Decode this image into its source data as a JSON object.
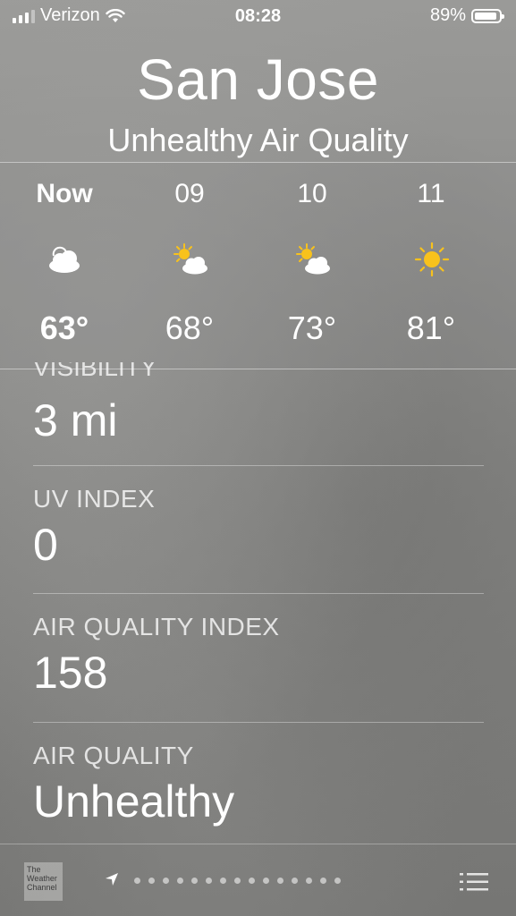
{
  "status_bar": {
    "carrier": "Verizon",
    "time": "08:28",
    "battery": "89%"
  },
  "city": "San Jose",
  "condition": "Unhealthy Air Quality",
  "hourly": [
    {
      "label": "Now",
      "icon": "cloud-icon",
      "temp": "63°"
    },
    {
      "label": "09",
      "icon": "partly-sunny-icon",
      "temp": "68°"
    },
    {
      "label": "10",
      "icon": "partly-sunny-icon",
      "temp": "73°"
    },
    {
      "label": "11",
      "icon": "sun-icon",
      "temp": "81°"
    }
  ],
  "details": {
    "visibility_label": "VISIBILITY",
    "visibility_value": "3 mi",
    "uv_label": "UV INDEX",
    "uv_value": "0",
    "aqi_label": "AIR QUALITY INDEX",
    "aqi_value": "158",
    "aq_label": "AIR QUALITY",
    "aq_value": "Unhealthy"
  },
  "bottom_bar": {
    "logo_text": "The Weather Channel",
    "page_dots": 15
  },
  "colors": {
    "sun": "#f8c21c",
    "text": "#ffffff"
  }
}
